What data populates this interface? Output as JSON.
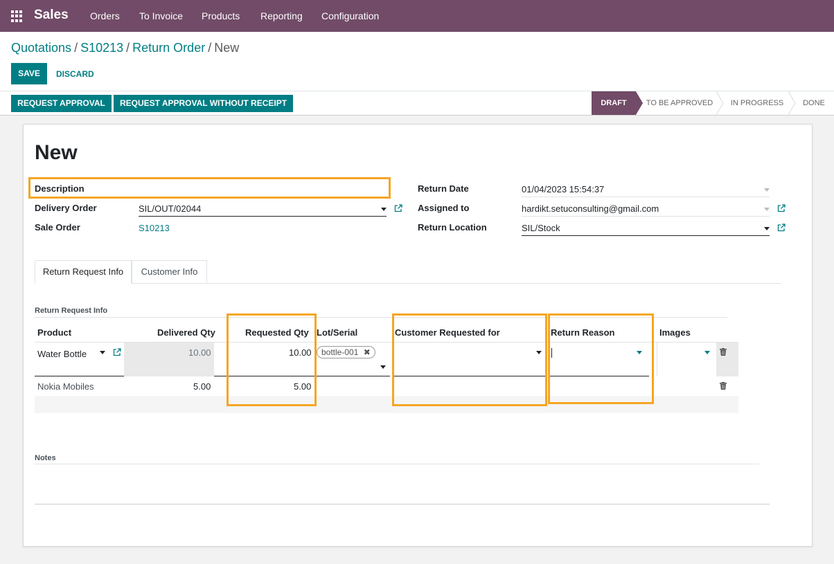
{
  "topbar": {
    "app_name": "Sales",
    "menu": [
      "Orders",
      "To Invoice",
      "Products",
      "Reporting",
      "Configuration"
    ],
    "bg_color": "#714b67"
  },
  "breadcrumb": {
    "items": [
      "Quotations",
      "S10213",
      "Return Order"
    ],
    "current": "New",
    "separator": "/"
  },
  "buttons": {
    "save": "SAVE",
    "discard": "DISCARD",
    "request_approval": "REQUEST APPROVAL",
    "request_approval_no_receipt": "REQUEST APPROVAL WITHOUT RECEIPT"
  },
  "stages": [
    "DRAFT",
    "TO BE APPROVED",
    "IN PROGRESS",
    "DONE"
  ],
  "active_stage": "DRAFT",
  "form": {
    "title": "New",
    "left_fields": {
      "description_label": "Description",
      "delivery_order_label": "Delivery Order",
      "delivery_order_value": "SIL/OUT/02044",
      "sale_order_label": "Sale Order",
      "sale_order_value": "S10213"
    },
    "right_fields": {
      "return_date_label": "Return Date",
      "return_date_value": "01/04/2023 15:54:37",
      "assigned_to_label": "Assigned to",
      "assigned_to_value": "hardikt.setuconsulting@gmail.com",
      "return_location_label": "Return Location",
      "return_location_value": "SIL/Stock"
    }
  },
  "tabs": [
    "Return Request Info",
    "Customer Info"
  ],
  "lines": {
    "section_label": "Return Request Info",
    "headers": {
      "product": "Product",
      "delivered_qty": "Delivered Qty",
      "requested_qty": "Requested Qty",
      "lot_serial": "Lot/Serial",
      "customer_requested_for": "Customer Requested for",
      "return_reason": "Return Reason",
      "images": "Images"
    },
    "rows": [
      {
        "product": "Water Bottle",
        "delivered_qty": "10.00",
        "requested_qty": "10.00",
        "lot": "bottle-001"
      },
      {
        "product": "Nokia Mobiles",
        "delivered_qty": "5.00",
        "requested_qty": "5.00",
        "lot": ""
      }
    ]
  },
  "notes_label": "Notes",
  "icons": [
    "apps-grid-icon",
    "external-link-icon",
    "trash-icon",
    "remove-tag-icon",
    "dropdown-caret-icon"
  ],
  "colors": {
    "primary": "#017e84",
    "highlight": "#f5a623",
    "brand": "#714b67"
  }
}
